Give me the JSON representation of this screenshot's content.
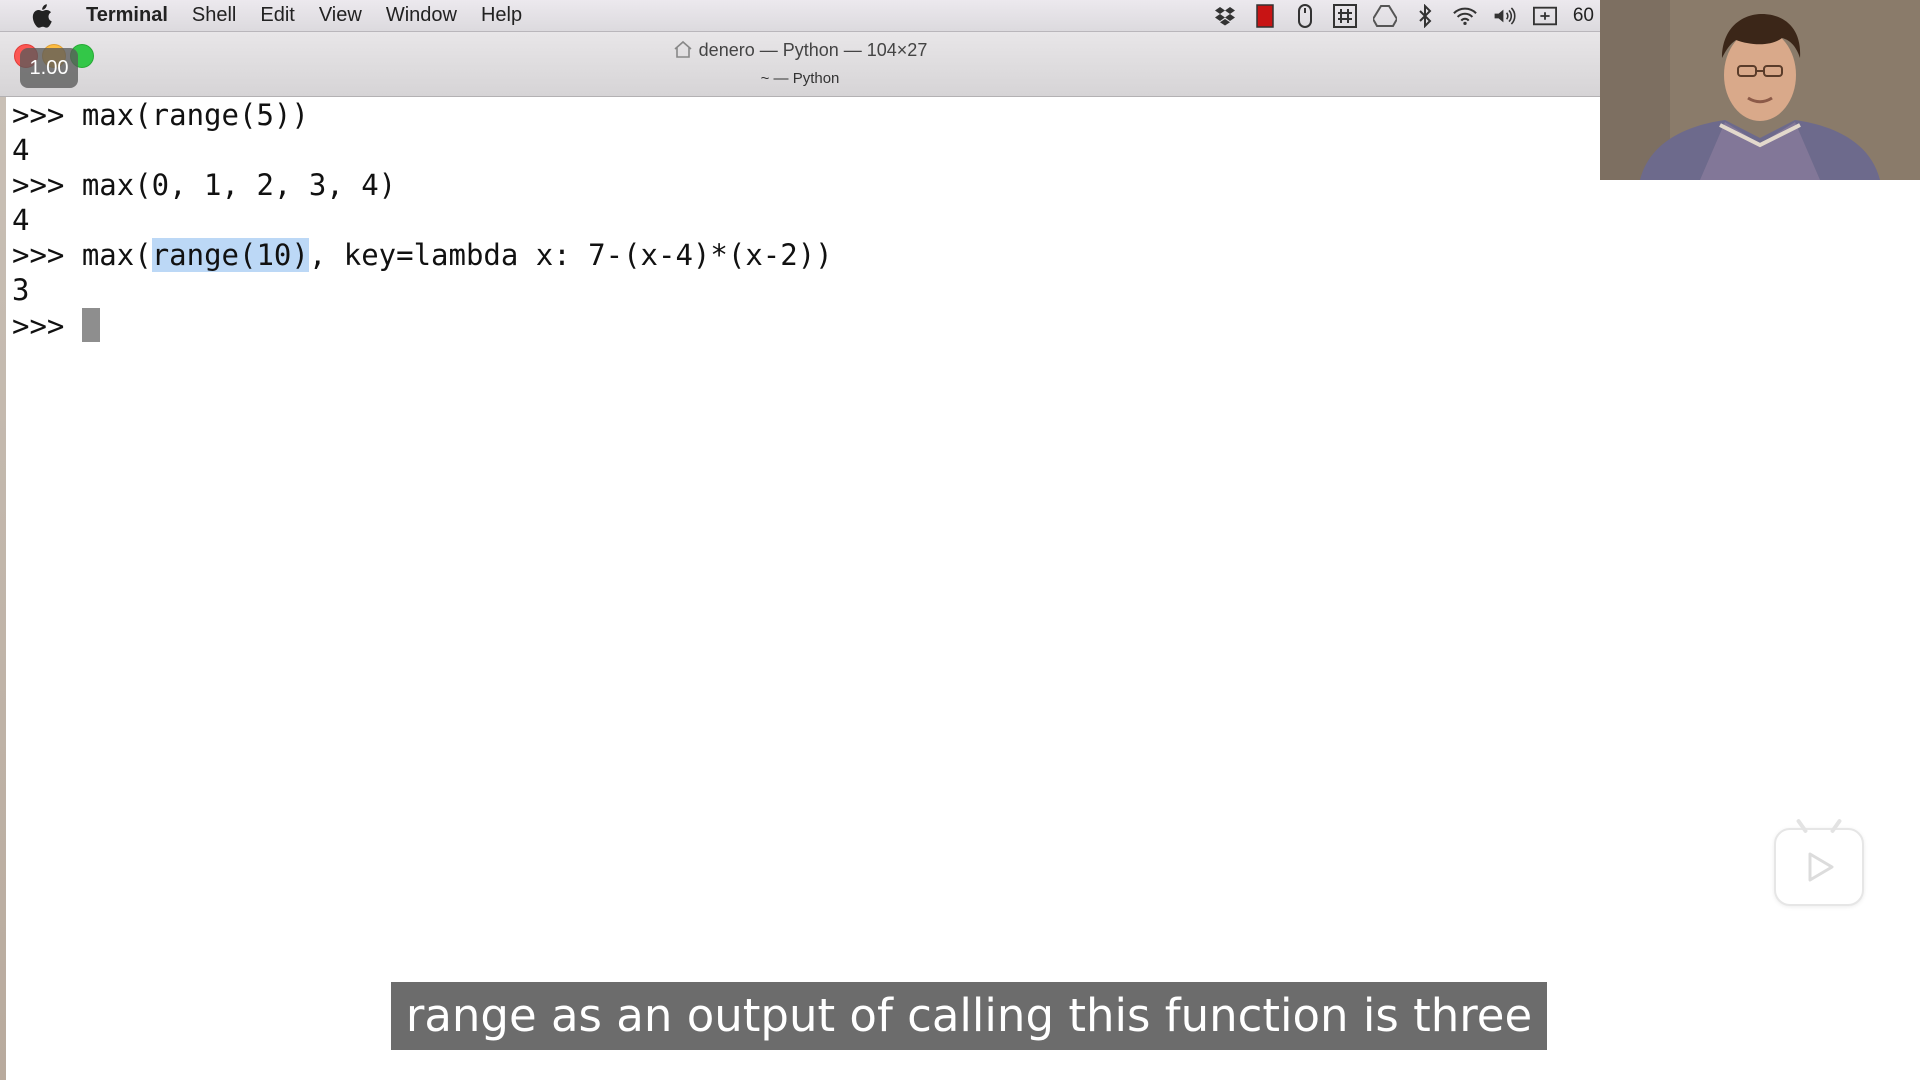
{
  "menubar": {
    "app_name": "Terminal",
    "items": [
      "Shell",
      "Edit",
      "View",
      "Window",
      "Help"
    ],
    "clock": "60"
  },
  "window": {
    "speed_badge": "1.00",
    "title": "denero — Python — 104×27",
    "tab_label": "~ — Python"
  },
  "terminal": {
    "lines": [
      {
        "prompt": ">>> ",
        "text": "max(range(5))"
      },
      {
        "output": "4"
      },
      {
        "prompt": ">>> ",
        "text": "max(0, 1, 2, 3, 4)"
      },
      {
        "output": "4"
      },
      {
        "prompt": ">>> ",
        "text_before": "max(",
        "selected": "range(10)",
        "text_after": ", key=lambda x: 7-(x-4)*(x-2))"
      },
      {
        "output": "3"
      },
      {
        "prompt": ">>> "
      }
    ]
  },
  "subtitle": "range as an output of calling this function is three",
  "colors": {
    "selection": "#bcd8f6",
    "cursor": "#8e8e8e",
    "subtitle_bg": "#5f5f5f"
  },
  "icons": [
    "apple-icon",
    "dropbox-icon",
    "battery-red-icon",
    "mouse-icon",
    "hash-icon",
    "drive-icon",
    "bluetooth-icon",
    "wifi-icon",
    "volume-icon",
    "keyboard-icon",
    "home-icon",
    "play-icon"
  ]
}
